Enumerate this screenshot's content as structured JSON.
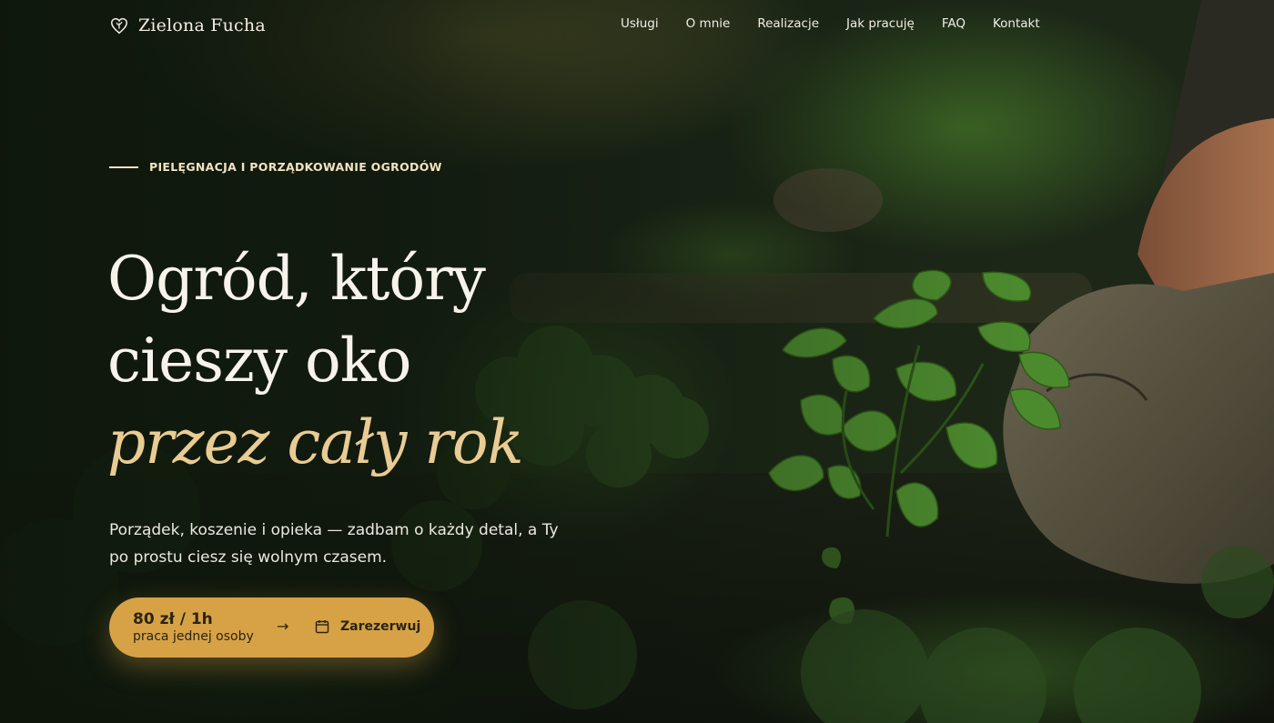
{
  "brand": {
    "name": "Zielona Fucha",
    "icon": "leaf-heart-icon"
  },
  "nav": {
    "items": [
      "Usługi",
      "O mnie",
      "Realizacje",
      "Jak pracuję",
      "FAQ",
      "Kontakt"
    ]
  },
  "hero": {
    "kicker": "PIELĘGNACJA I PORZĄDKOWANIE OGRODÓW",
    "headline_line1": "Ogród, który",
    "headline_line2": "cieszy oko",
    "headline_line3": "przez cały rok",
    "lead": "Porządek, koszenie i opieka — zadbam o każdy detal, a Ty po prostu ciesz się wolnym czasem.",
    "cta": {
      "price": "80 zł / 1h",
      "price_note": "praca jednej osoby",
      "arrow": "→",
      "calendar_icon": "calendar-icon",
      "label": "Zarezerwuj"
    }
  },
  "colors": {
    "accent": "#d7a246",
    "highlight": "#e9cc94",
    "text": "#f7f3ea",
    "kicker": "#f2e3c1"
  }
}
